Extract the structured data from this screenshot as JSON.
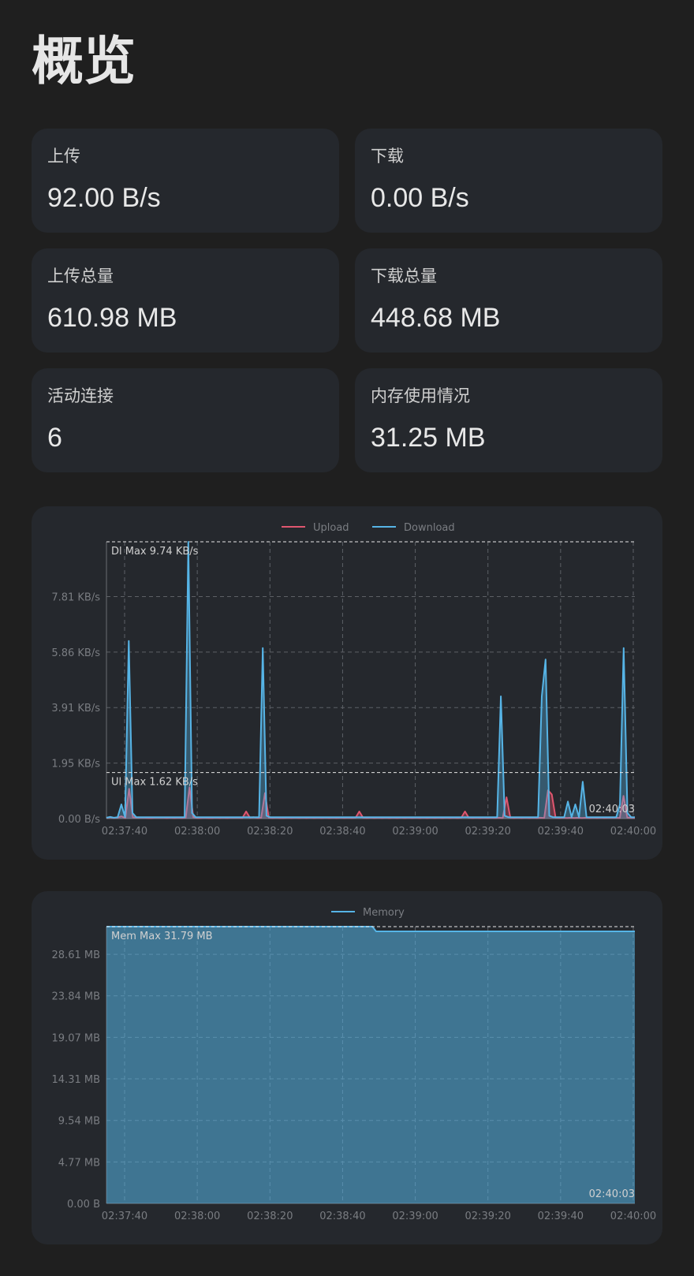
{
  "page": {
    "title": "概览"
  },
  "stats": [
    {
      "label": "上传",
      "value": "92.00 B/s"
    },
    {
      "label": "下载",
      "value": "0.00 B/s"
    },
    {
      "label": "上传总量",
      "value": "610.98 MB"
    },
    {
      "label": "下载总量",
      "value": "448.68 MB"
    },
    {
      "label": "活动连接",
      "value": "6"
    },
    {
      "label": "内存使用情况",
      "value": "31.25 MB"
    }
  ],
  "colors": {
    "upload": "#e0566f",
    "download": "#56b4e6",
    "memory": "#56b4e6"
  },
  "chart_data": [
    {
      "type": "line",
      "legend_position": "top",
      "grid": true,
      "x": [
        "02:37:40",
        "02:38:00",
        "02:38:20",
        "02:38:40",
        "02:39:00",
        "02:39:20",
        "02:39:40",
        "02:40:00"
      ],
      "x_ticks": [
        "02:37:40",
        "02:38:00",
        "02:38:20",
        "02:38:40",
        "02:39:00",
        "02:39:20",
        "02:39:40",
        "02:40:00"
      ],
      "y_ticks": [
        "0.00 B/s",
        "1.95 KB/s",
        "3.91 KB/s",
        "5.86 KB/s",
        "7.81 KB/s"
      ],
      "ylim": [
        0,
        9.74
      ],
      "yunit": "KB/s",
      "series": [
        {
          "name": "Upload",
          "values": [
            0.02,
            0.05,
            0.02,
            0.04,
            0.08,
            0.02,
            1.05,
            0.05,
            0.03,
            0.03,
            0.03,
            0.02,
            0.02,
            0.03,
            0.03,
            0.03,
            0.02,
            0.03,
            0.02,
            0.03,
            0.02,
            0.03,
            1.1,
            0.05,
            0.02,
            0.02,
            0.03,
            0.02,
            0.02,
            0.03,
            0.02,
            0.03,
            0.02,
            0.03,
            0.03,
            0.03,
            0.02,
            0.25,
            0.03,
            0.05,
            0.02,
            0.03,
            0.9,
            0.03,
            0.02,
            0.03,
            0.02,
            0.02,
            0.03,
            0.02,
            0.03,
            0.02,
            0.03,
            0.02,
            0.03,
            0.02,
            0.03,
            0.02,
            0.03,
            0.02,
            0.03,
            0.02,
            0.03,
            0.02,
            0.03,
            0.02,
            0.03,
            0.25,
            0.03,
            0.02,
            0.03,
            0.02,
            0.03,
            0.02,
            0.03,
            0.02,
            0.03,
            0.02,
            0.03,
            0.02,
            0.03,
            0.02,
            0.03,
            0.02,
            0.03,
            0.02,
            0.03,
            0.02,
            0.03,
            0.02,
            0.03,
            0.02,
            0.03,
            0.02,
            0.03,
            0.25,
            0.03,
            0.02,
            0.03,
            0.02,
            0.03,
            0.02,
            0.03,
            0.02,
            0.03,
            0.02,
            0.75,
            0.03,
            0.02,
            0.03,
            0.02,
            0.03,
            0.02,
            0.03,
            0.02,
            0.03,
            0.02,
            1.0,
            0.85,
            0.03,
            0.02,
            0.03,
            0.02,
            0.03,
            0.02,
            0.03,
            0.02,
            0.03,
            0.02,
            0.03,
            0.02,
            0.03,
            0.02,
            0.03,
            0.03,
            0.03,
            0.02,
            0.8,
            0.04,
            0.03,
            0.02
          ],
          "max_label": "Ul Max 1.62 KB/s",
          "max": 1.62
        },
        {
          "name": "Download",
          "values": [
            0.03,
            0.06,
            0.03,
            0.05,
            0.5,
            0.05,
            6.25,
            0.2,
            0.05,
            0.05,
            0.05,
            0.05,
            0.05,
            0.05,
            0.05,
            0.05,
            0.05,
            0.05,
            0.05,
            0.05,
            0.05,
            0.05,
            9.74,
            0.2,
            0.05,
            0.05,
            0.05,
            0.05,
            0.05,
            0.05,
            0.05,
            0.05,
            0.05,
            0.05,
            0.05,
            0.05,
            0.05,
            0.05,
            0.05,
            0.05,
            0.05,
            0.05,
            6.0,
            0.1,
            0.05,
            0.05,
            0.05,
            0.05,
            0.05,
            0.05,
            0.05,
            0.05,
            0.05,
            0.05,
            0.05,
            0.05,
            0.05,
            0.05,
            0.05,
            0.05,
            0.05,
            0.05,
            0.05,
            0.05,
            0.05,
            0.05,
            0.05,
            0.05,
            0.05,
            0.05,
            0.05,
            0.05,
            0.05,
            0.05,
            0.05,
            0.05,
            0.05,
            0.05,
            0.05,
            0.05,
            0.05,
            0.05,
            0.05,
            0.05,
            0.05,
            0.05,
            0.05,
            0.05,
            0.05,
            0.05,
            0.05,
            0.05,
            0.05,
            0.05,
            0.05,
            0.05,
            0.05,
            0.05,
            0.05,
            0.05,
            0.05,
            0.05,
            0.05,
            0.05,
            0.05,
            0.05,
            4.3,
            0.1,
            0.05,
            0.05,
            0.05,
            0.05,
            0.05,
            0.05,
            0.05,
            0.05,
            0.05,
            4.3,
            5.6,
            0.1,
            0.05,
            0.05,
            0.05,
            0.05,
            0.6,
            0.05,
            0.5,
            0.05,
            1.3,
            0.05,
            0.05,
            0.05,
            0.05,
            0.05,
            0.05,
            0.05,
            0.05,
            0.05,
            0.5,
            6.0,
            0.2,
            0.05,
            0.05
          ],
          "max_label": "Dl Max 9.74 KB/s",
          "max": 9.74
        }
      ],
      "last_time_label": "02:40:03"
    },
    {
      "type": "area",
      "legend_position": "top",
      "grid": true,
      "x_ticks": [
        "02:37:40",
        "02:38:00",
        "02:38:20",
        "02:38:40",
        "02:39:00",
        "02:39:20",
        "02:39:40",
        "02:40:00"
      ],
      "y_ticks": [
        "0.00 B",
        "4.77 MB",
        "9.54 MB",
        "14.31 MB",
        "19.07 MB",
        "23.84 MB",
        "28.61 MB"
      ],
      "ylim": [
        0,
        31.79
      ],
      "yunit": "MB",
      "series": [
        {
          "name": "Memory",
          "values": [
            31.79,
            31.79,
            31.79,
            31.79,
            31.79,
            31.79,
            31.79,
            31.79,
            31.79,
            31.79,
            31.79,
            31.79,
            31.79,
            31.79,
            31.79,
            31.79,
            31.79,
            31.79,
            31.79,
            31.79,
            31.79,
            31.79,
            31.79,
            31.79,
            31.79,
            31.79,
            31.79,
            31.79,
            31.79,
            31.79,
            31.79,
            31.79,
            31.79,
            31.79,
            31.79,
            31.79,
            31.79,
            31.79,
            31.79,
            31.79,
            31.79,
            31.79,
            31.79,
            31.79,
            31.79,
            31.79,
            31.79,
            31.79,
            31.79,
            31.79,
            31.79,
            31.79,
            31.79,
            31.79,
            31.79,
            31.79,
            31.79,
            31.79,
            31.79,
            31.79,
            31.79,
            31.79,
            31.79,
            31.79,
            31.79,
            31.79,
            31.79,
            31.79,
            31.79,
            31.79,
            31.79,
            31.79,
            31.79,
            31.79,
            31.25,
            31.25,
            31.25,
            31.25,
            31.25,
            31.25,
            31.25,
            31.25,
            31.25,
            31.25,
            31.25,
            31.25,
            31.25,
            31.25,
            31.25,
            31.25,
            31.25,
            31.25,
            31.25,
            31.25,
            31.25,
            31.25,
            31.25,
            31.25,
            31.25,
            31.25,
            31.25,
            31.25,
            31.25,
            31.25,
            31.25,
            31.25,
            31.25,
            31.25,
            31.25,
            31.25,
            31.25,
            31.25,
            31.25,
            31.25,
            31.25,
            31.25,
            31.25,
            31.25,
            31.25,
            31.25,
            31.25,
            31.25,
            31.25,
            31.25,
            31.25,
            31.25,
            31.25,
            31.25,
            31.25,
            31.25,
            31.25,
            31.25,
            31.25,
            31.25,
            31.25,
            31.25,
            31.25,
            31.25,
            31.25,
            31.25,
            31.25,
            31.25,
            31.25,
            31.25,
            31.25,
            31.25
          ],
          "max_label": "Mem Max 31.79 MB",
          "max": 31.79
        }
      ],
      "last_time_label": "02:40:03"
    }
  ]
}
